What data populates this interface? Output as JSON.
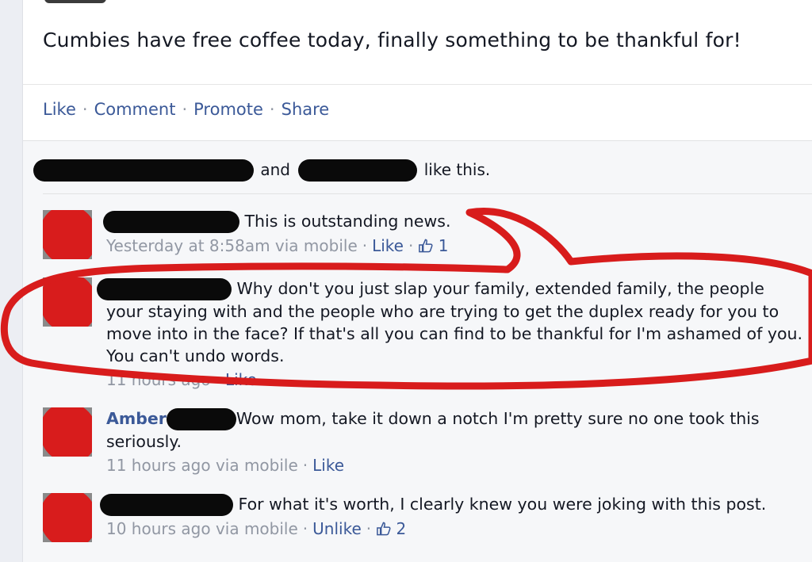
{
  "post": {
    "text": "Cumbies have free coffee today, finally something to be thankful for!"
  },
  "actions": {
    "like": "Like",
    "comment": "Comment",
    "promote": "Promote",
    "share": "Share",
    "separator": "·"
  },
  "likes": {
    "and": "and",
    "suffix": "like this."
  },
  "comments": [
    {
      "text": "This is outstanding news.",
      "time": "Yesterday at 8:58am via mobile",
      "like": "Like",
      "like_count": "1"
    },
    {
      "text": "Why don't you just slap your family, extended family, the people your staying with and the people who are trying to get the duplex ready for you to move into in the face? If that's all you can find to be thankful for I'm ashamed of you. You can't undo words.",
      "time": "11 hours ago",
      "like": "Like"
    },
    {
      "name": "Amber",
      "text": "Wow mom, take it down a notch I'm pretty sure no one took this seriously.",
      "time": "11 hours ago via mobile",
      "like": "Like"
    },
    {
      "text": "For what it's worth, I clearly knew you were joking with this post.",
      "time": "10 hours ago via mobile",
      "like": "Unlike",
      "like_count": "2"
    }
  ],
  "icons": {
    "like_count_icon": "thumbs-up-icon"
  },
  "colors": {
    "link": "#3b5998",
    "meta": "#9197a3",
    "annotation_red": "#d81c1c",
    "redaction": "#0a0a0a"
  }
}
